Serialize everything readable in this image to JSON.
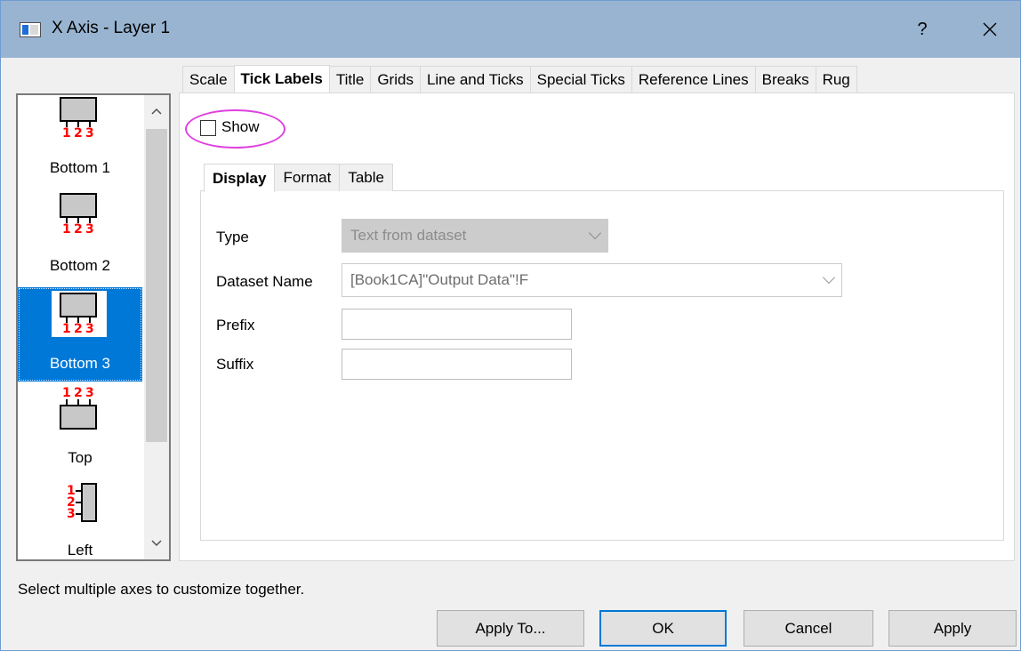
{
  "window": {
    "title": "X Axis - Layer 1",
    "help_label": "?",
    "close_label": "✕"
  },
  "axis_list": {
    "items": [
      {
        "label": "Bottom 1",
        "icon": "bottom-axis-icon"
      },
      {
        "label": "Bottom 2",
        "icon": "bottom-axis-icon"
      },
      {
        "label": "Bottom 3",
        "icon": "bottom-axis-icon",
        "selected": true
      },
      {
        "label": "Top",
        "icon": "top-axis-icon"
      },
      {
        "label": "Left",
        "icon": "left-axis-icon"
      }
    ],
    "tick_numbers": [
      "1",
      "2",
      "3"
    ],
    "scroll_up": "^",
    "scroll_down": "v"
  },
  "outer_tabs": [
    {
      "label": "Scale"
    },
    {
      "label": "Tick Labels",
      "active": true
    },
    {
      "label": "Title"
    },
    {
      "label": "Grids"
    },
    {
      "label": "Line and Ticks"
    },
    {
      "label": "Special Ticks"
    },
    {
      "label": "Reference Lines"
    },
    {
      "label": "Breaks"
    },
    {
      "label": "Rug"
    }
  ],
  "show": {
    "label": "Show",
    "checked": false
  },
  "inner_tabs": [
    {
      "label": "Display",
      "active": true
    },
    {
      "label": "Format"
    },
    {
      "label": "Table"
    }
  ],
  "form": {
    "type_label": "Type",
    "type_value": "Text from dataset",
    "dataset_label": "Dataset Name",
    "dataset_value": "[Book1CA]\"Output Data\"!F",
    "prefix_label": "Prefix",
    "prefix_value": "",
    "suffix_label": "Suffix",
    "suffix_value": ""
  },
  "status": "Select multiple axes to customize together.",
  "buttons": {
    "apply_to": "Apply To...",
    "ok": "OK",
    "cancel": "Cancel",
    "apply": "Apply"
  },
  "colors": {
    "titlebar": "#99b4d1",
    "selection": "#0078d7",
    "tick_numbers": "#ff0000",
    "highlight": "#e040e0"
  }
}
